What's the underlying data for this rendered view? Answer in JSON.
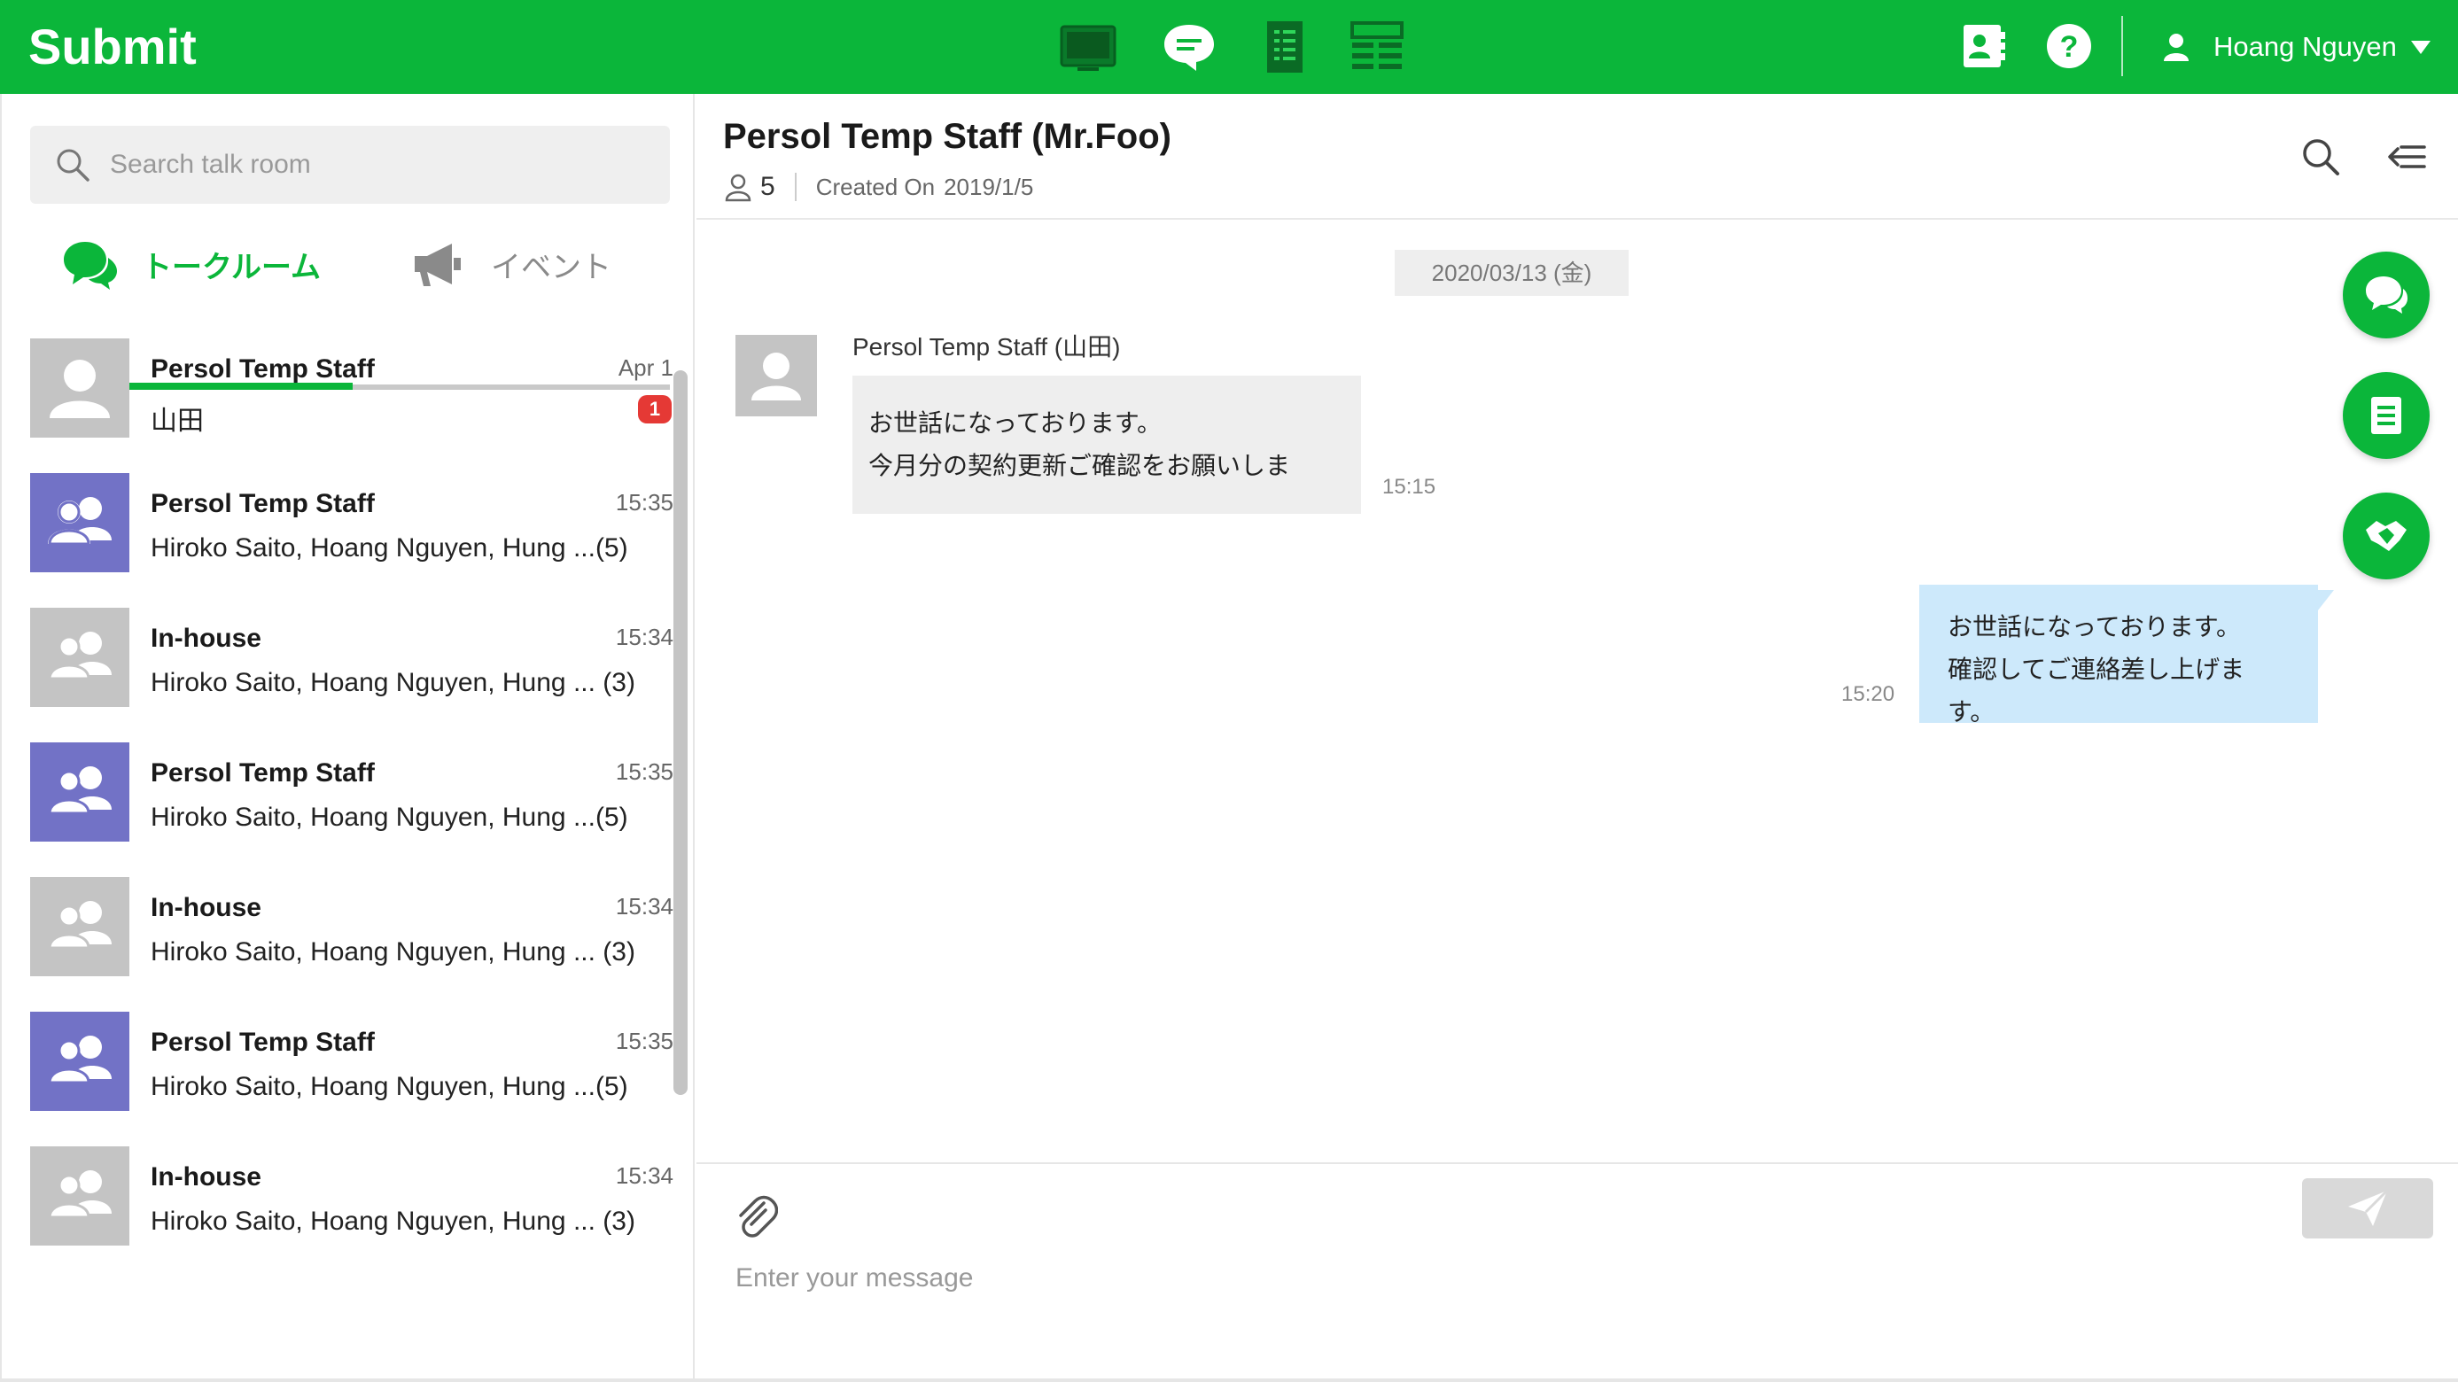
{
  "app": {
    "brand": "Submit"
  },
  "header": {
    "nav_icons": [
      "monitor-icon",
      "chat-bubble-icon",
      "form-document-icon",
      "table-grid-icon"
    ],
    "right_icons": [
      "contact-card-icon",
      "help-icon"
    ],
    "user_name": "Hoang Nguyen"
  },
  "sidebar": {
    "search_placeholder": "Search talk room",
    "tabs": [
      {
        "label": "トークルーム",
        "icon": "chat-icon",
        "active": true
      },
      {
        "label": "イベント",
        "icon": "megaphone-icon",
        "active": false
      }
    ],
    "rooms": [
      {
        "name": "Persol Temp Staff",
        "time": "Apr 1",
        "preview": "山田",
        "avatar": "single",
        "badge": "1"
      },
      {
        "name": "Persol Temp Staff",
        "time": "15:35",
        "preview": "Hiroko Saito, Hoang Nguyen, Hung ...(5)",
        "avatar": "group-purple"
      },
      {
        "name": "In-house",
        "time": "15:34",
        "preview": "Hiroko Saito, Hoang Nguyen, Hung ... (3)",
        "avatar": "group-gray"
      },
      {
        "name": "Persol Temp Staff",
        "time": "15:35",
        "preview": "Hiroko Saito, Hoang Nguyen, Hung ...(5)",
        "avatar": "group-purple"
      },
      {
        "name": "In-house",
        "time": "15:34",
        "preview": "Hiroko Saito, Hoang Nguyen, Hung ... (3)",
        "avatar": "group-gray"
      },
      {
        "name": "Persol Temp Staff",
        "time": "15:35",
        "preview": "Hiroko Saito, Hoang Nguyen, Hung ...(5)",
        "avatar": "group-purple"
      },
      {
        "name": "In-house",
        "time": "15:34",
        "preview": "Hiroko Saito, Hoang Nguyen, Hung ... (3)",
        "avatar": "group-gray"
      }
    ]
  },
  "chat": {
    "title": "Persol Temp Staff (Mr.Foo)",
    "member_count": "5",
    "created_label": "Created On",
    "created_date": "2019/1/5",
    "date_divider": "2020/03/13 (金)",
    "incoming": {
      "sender": "Persol Temp Staff (山田)",
      "line1": "お世話になっております。",
      "line2": "今月分の契約更新ご確認をお願いしま",
      "time": "15:15"
    },
    "outgoing": {
      "line1": "お世話になっております。",
      "line2": "確認してご連絡差し上げます。",
      "time": "15:20"
    },
    "message_placeholder": "Enter your message"
  },
  "colors": {
    "brand_green": "#0bb63a",
    "group_avatar_purple": "#7272c6",
    "avatar_gray": "#c4c4c4",
    "outgoing_bubble": "#cde9fb",
    "badge_red": "#e53935"
  }
}
